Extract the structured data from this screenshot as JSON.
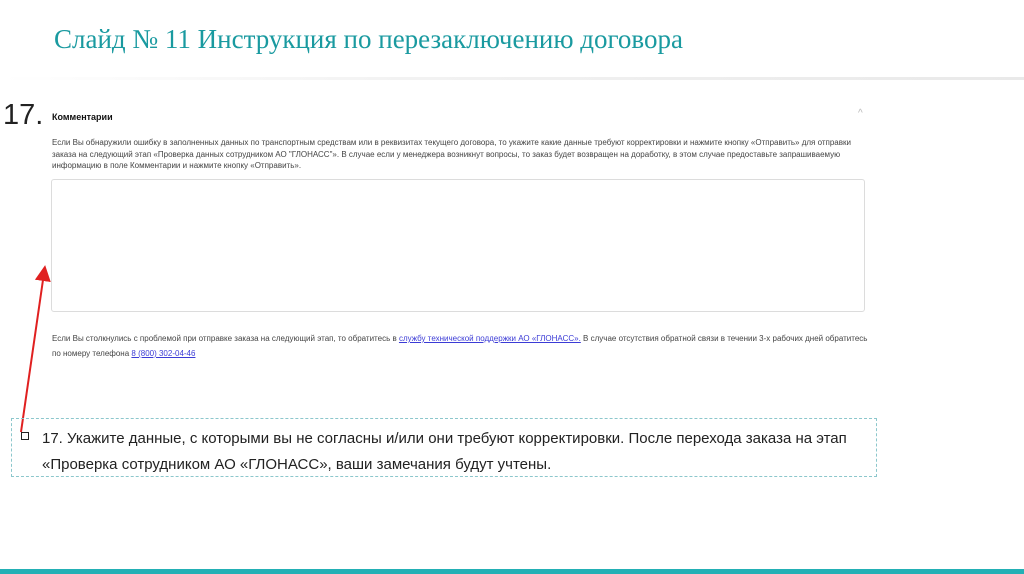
{
  "slide": {
    "title": "Слайд № 11 Инструкция по перезаключению договора",
    "step_number": "17."
  },
  "comments_panel": {
    "header": "Комментарии",
    "chevron_glyph": "^",
    "description": "Если Вы обнаружили ошибку в заполненных данных по транспортным средствам или в реквизитах текущего договора, то укажите какие данные требуют корректировки и нажмите кнопку «Отправить» для отправки заказа на следующий этап «Проверка данных сотрудником АО \"ГЛОНАСС\"». В случае если у менеджера возникнут вопросы, то заказ будет возвращен на доработку, в этом случае предоставьте запрашиваемую информацию в поле Комментарии и нажмите кнопку «Отправить».",
    "textarea_value": "",
    "support_prefix": "Если Вы столкнулись с проблемой при отправке заказа на следующий этап, то обратитесь в ",
    "support_link": "службу технической поддержки АО «ГЛОНАСС».",
    "support_suffix": " В случае отсутствия обратной связи в течении 3-х рабочих дней обратитесь по номеру телефона ",
    "phone": "8 (800) 302-04-46"
  },
  "callout": {
    "text": "17. Укажите данные, с которыми вы не согласны и/или они требуют корректировки. После перехода заказа на этап «Проверка сотрудником АО «ГЛОНАСС», ваши замечания будут учтены."
  },
  "colors": {
    "title": "#1a9aa0",
    "accent_bar": "#23b0b5",
    "arrow": "#e02020",
    "link": "#3b3bd6"
  }
}
